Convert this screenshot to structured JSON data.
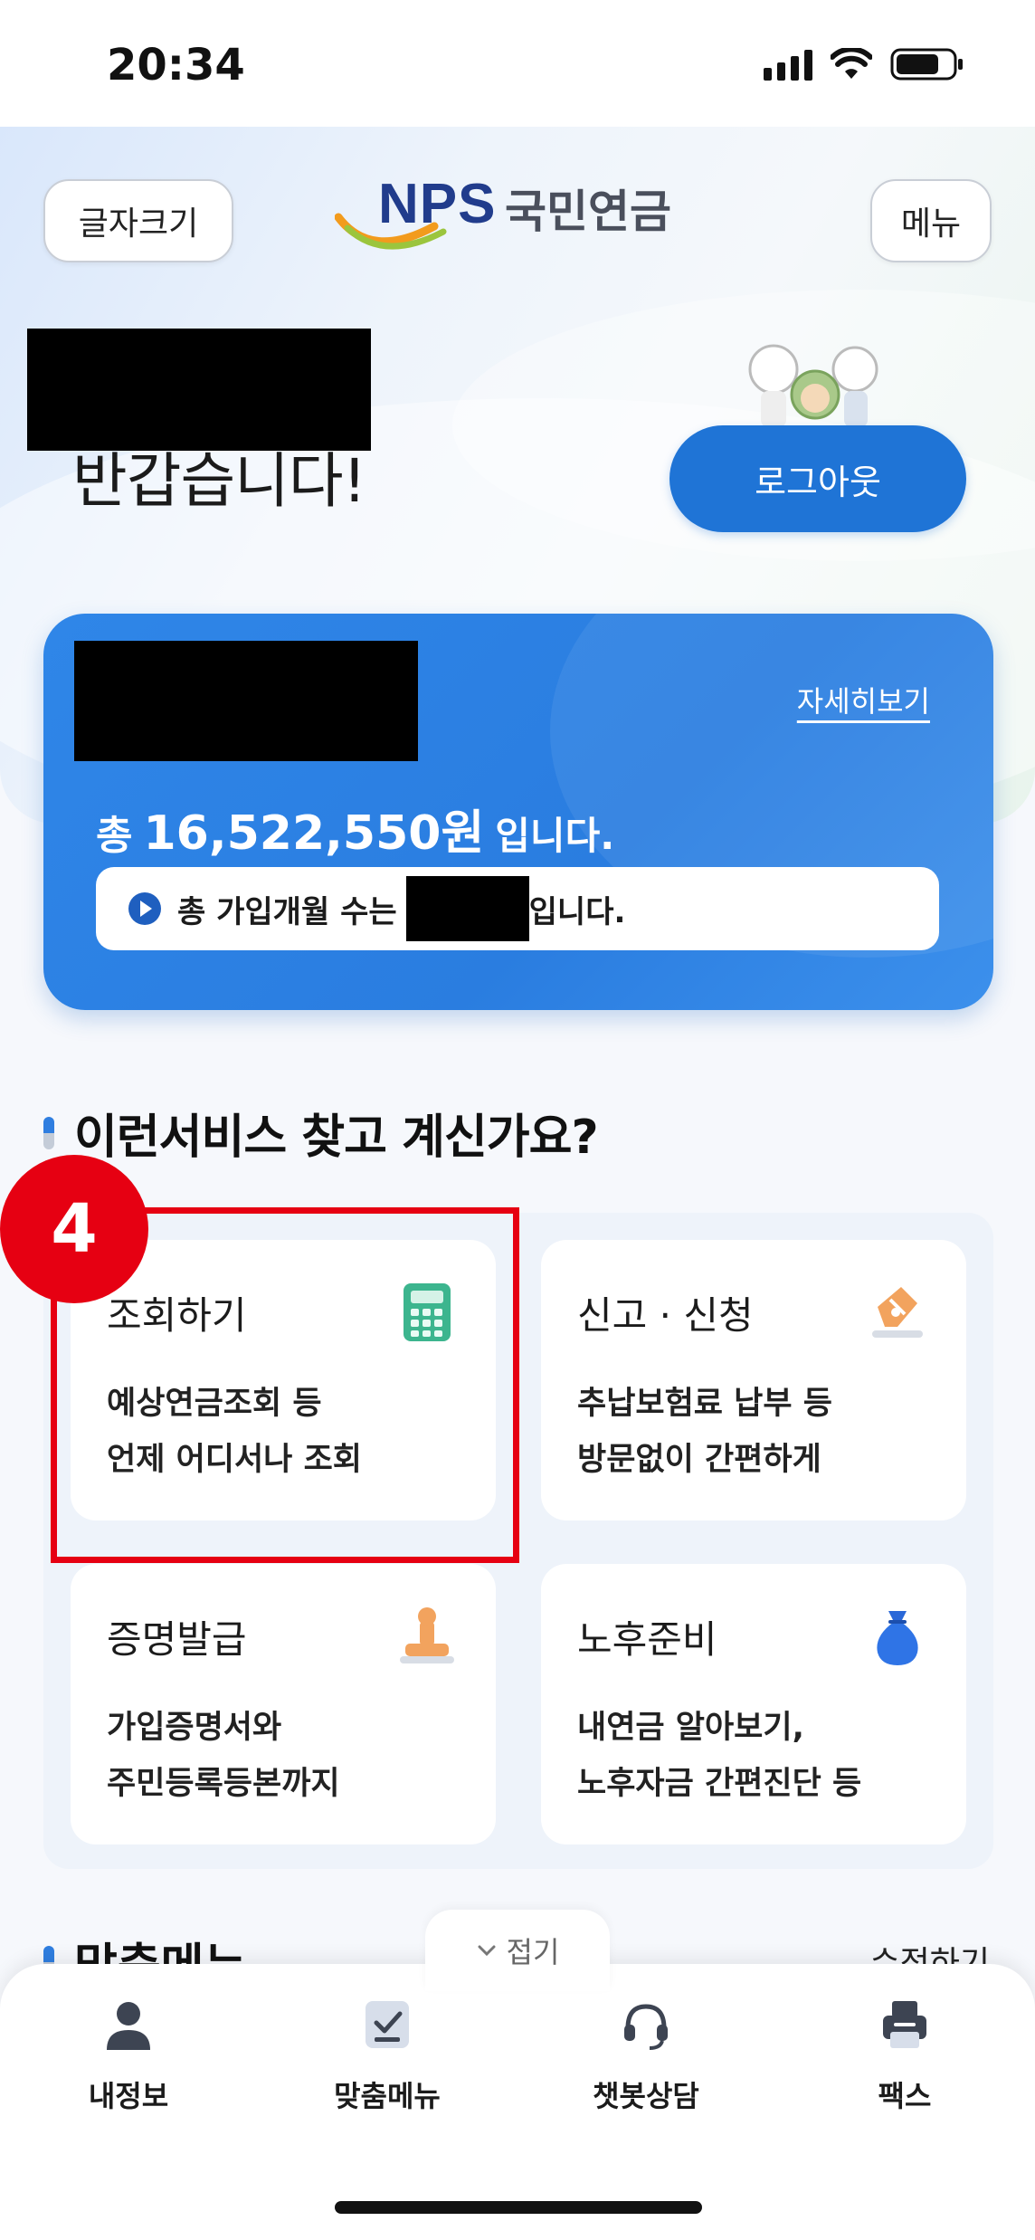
{
  "status_bar": {
    "time": "20:34"
  },
  "header": {
    "font_size_button": "글자크기",
    "menu_button": "메뉴",
    "logo_text": "NPS",
    "logo_kr": "국민연금"
  },
  "greeting": {
    "text": "반갑습니다!",
    "logout_button": "로그아웃"
  },
  "pension_card": {
    "detail_link": "자세히보기",
    "total_prefix": "총",
    "total_amount": "16,522,550원",
    "total_suffix": "입니다.",
    "months_prefix": "총 가입개월 수는",
    "months_suffix": "입니다."
  },
  "services": {
    "title": "이런서비스 찾고 계신가요?",
    "tiles": [
      {
        "title": "조회하기",
        "line1": "예상연금조회 등",
        "line2": "언제 어디서나 조회",
        "icon": "calculator-icon"
      },
      {
        "title": "신고 · 신청",
        "line1": "추납보험료 납부 등",
        "line2": "방문없이 간편하게",
        "icon": "pen-nib-icon"
      },
      {
        "title": "증명발급",
        "line1": "가입증명서와",
        "line2": "주민등록등본까지",
        "icon": "stamp-icon"
      },
      {
        "title": "노후준비",
        "line1": "내연금 알아보기,",
        "line2": "노후자금 간편진단 등",
        "icon": "money-bag-icon"
      }
    ],
    "step_badge": "4",
    "highlight_color": "#e60012"
  },
  "next_section": {
    "title": "맞춤메뉴",
    "edit_link": "수정하기",
    "collapse_label": "접기"
  },
  "bottom_nav": [
    {
      "label": "내정보",
      "icon": "person-icon"
    },
    {
      "label": "맞춤메뉴",
      "icon": "checklist-icon"
    },
    {
      "label": "챗봇상담",
      "icon": "headset-icon"
    },
    {
      "label": "팩스",
      "icon": "fax-icon"
    }
  ],
  "colors": {
    "primary": "#2f86e8",
    "logout": "#1f74d6",
    "logo_navy": "#213c8c"
  }
}
